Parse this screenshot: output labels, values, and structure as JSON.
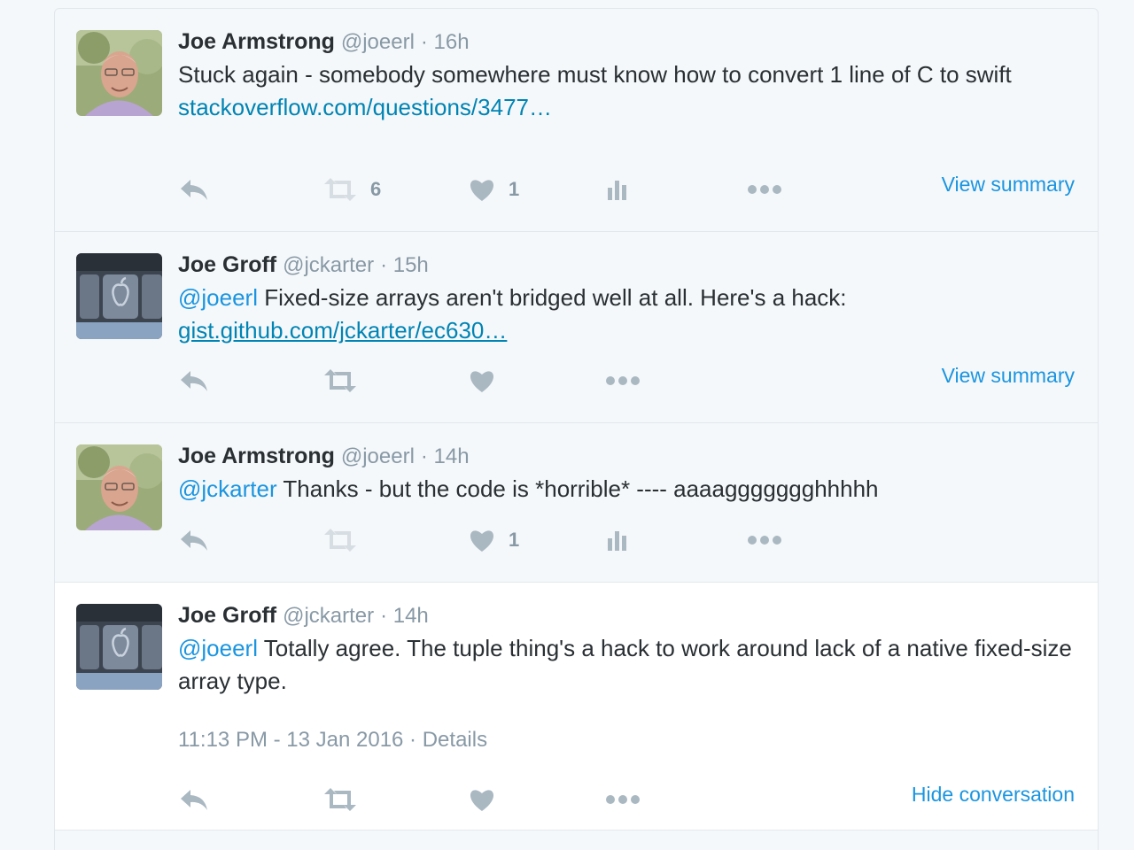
{
  "tweets": [
    {
      "name": "Joe Armstrong",
      "handle": "@joeerl",
      "time": "· 16h",
      "text": "Stuck again - somebody somewhere must know how to convert 1 line of C to swift",
      "link": "stackoverflow.com/questions/3477…",
      "retweet_count": "6",
      "like_count": "1",
      "summary": "View summary",
      "icons": [
        "reply-icon",
        "retweet-icon",
        "heart-icon",
        "analytics-icon",
        "more-icon"
      ]
    },
    {
      "name": "Joe Groff",
      "handle": "@jckarter",
      "time": "· 15h",
      "mention": "@joeerl",
      "text": "Fixed-size arrays aren't bridged well at all. Here's a hack:",
      "link": "gist.github.com/jckarter/ec630…",
      "summary": "View summary",
      "icons": [
        "reply-icon",
        "retweet-icon",
        "heart-icon",
        "more-icon"
      ]
    },
    {
      "name": "Joe Armstrong",
      "handle": "@joeerl",
      "time": "· 14h",
      "mention": "@jckarter",
      "text": "Thanks - but the code is *horrible* ---- aaaaggggggghhhhh",
      "like_count": "1",
      "icons": [
        "reply-icon",
        "retweet-icon",
        "heart-icon",
        "analytics-icon",
        "more-icon"
      ]
    },
    {
      "name": "Joe Groff",
      "handle": "@jckarter",
      "time": "· 14h",
      "mention": "@joeerl",
      "text": "Totally agree. The tuple thing's a hack to work around lack of a native fixed-size array type.",
      "timestamp": "11:13 PM - 13 Jan 2016 · Details",
      "hide": "Hide conversation",
      "icons": [
        "reply-icon",
        "retweet-icon",
        "heart-icon",
        "more-icon"
      ]
    }
  ],
  "colors": {
    "background": "#f5f8fa",
    "focused_background": "#ffffff",
    "text": "#292f33",
    "muted": "#8899a6",
    "link": "#0084b4",
    "mention": "#1b95e0",
    "icon": "#aab8c2",
    "border": "#e1e8ed"
  }
}
